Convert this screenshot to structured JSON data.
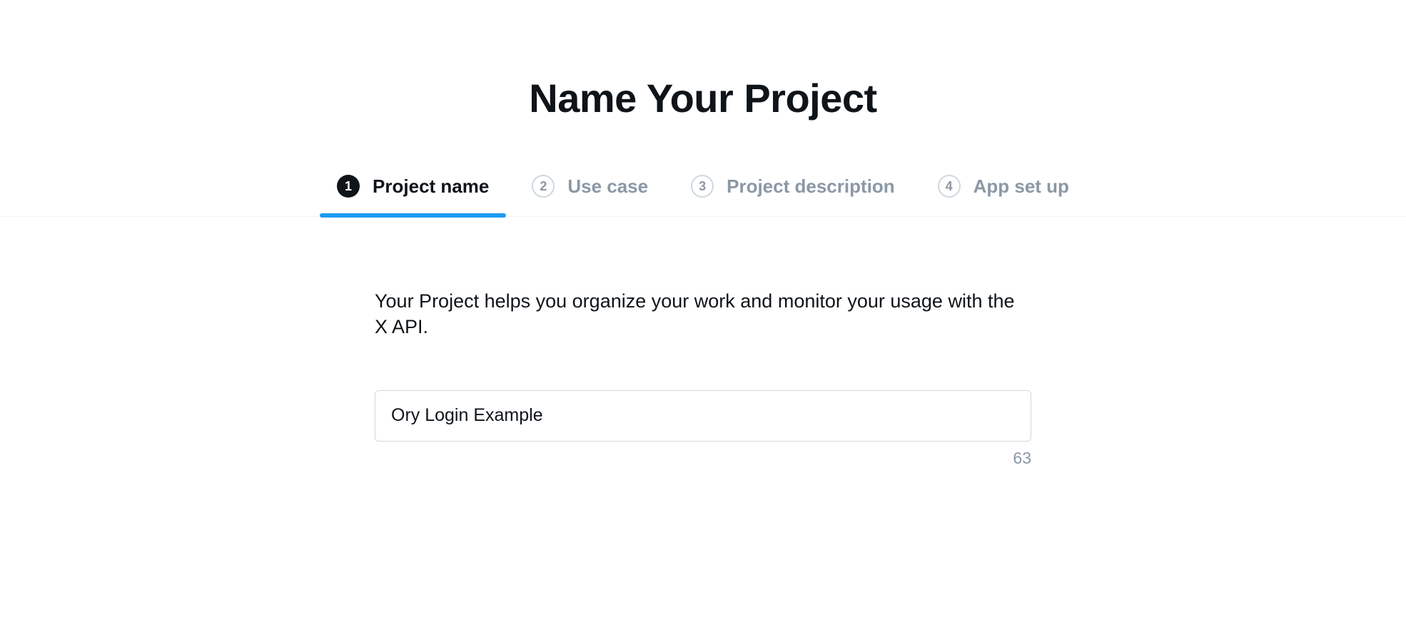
{
  "header": {
    "title": "Name Your Project"
  },
  "steps": [
    {
      "number": "1",
      "label": "Project name",
      "active": true
    },
    {
      "number": "2",
      "label": "Use case",
      "active": false
    },
    {
      "number": "3",
      "label": "Project description",
      "active": false
    },
    {
      "number": "4",
      "label": "App set up",
      "active": false
    }
  ],
  "content": {
    "description": "Your Project helps you organize your work and monitor your usage with the X API.",
    "input_value": "Ory Login Example",
    "char_remaining": "63"
  }
}
